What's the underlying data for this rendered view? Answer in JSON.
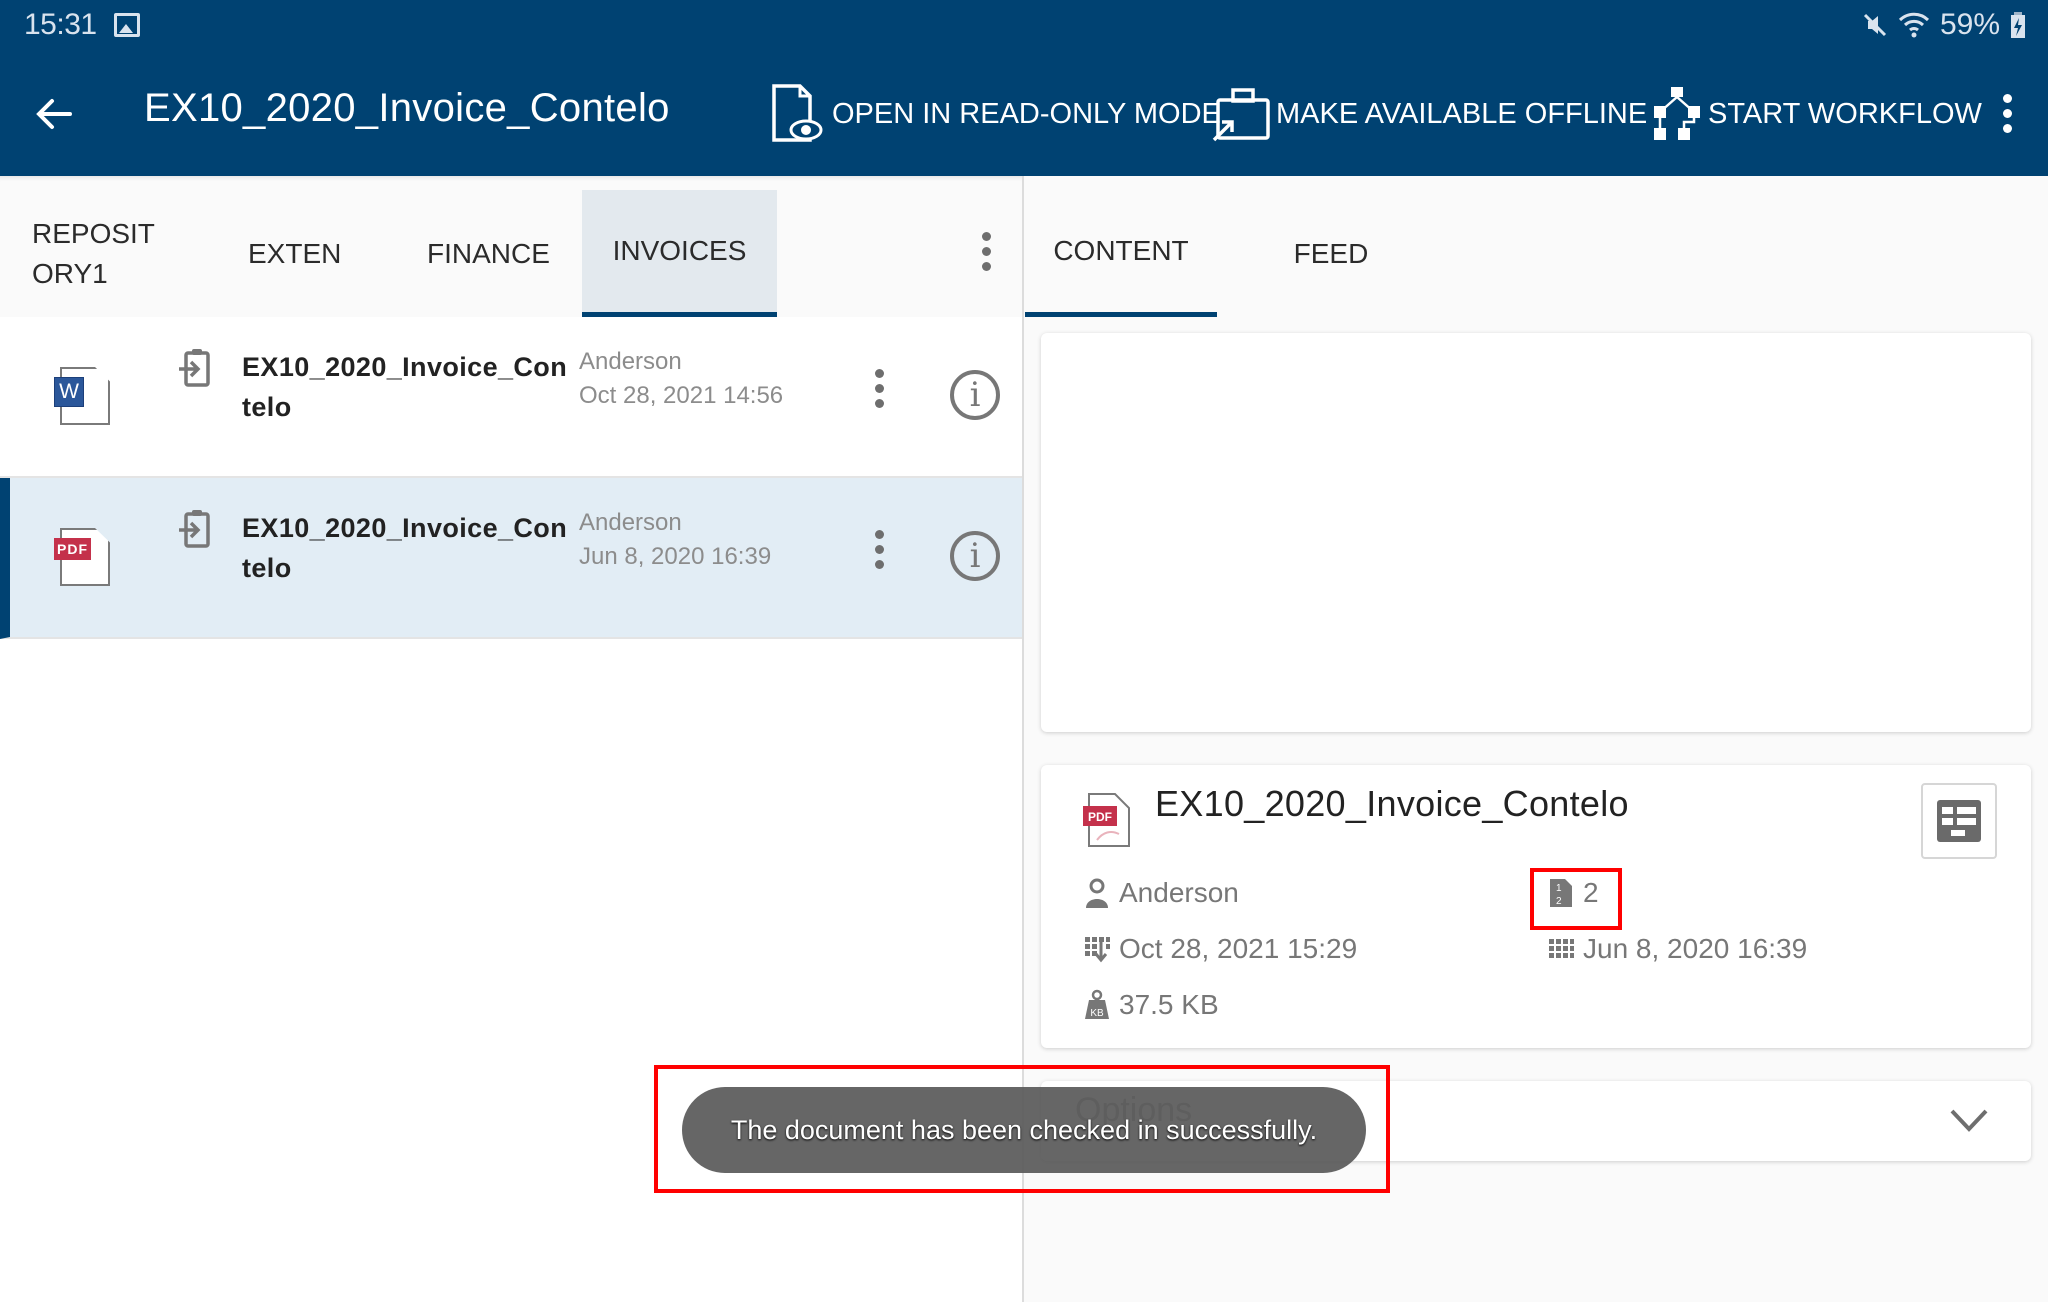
{
  "status_bar": {
    "time": "15:31",
    "battery": "59%",
    "icons": [
      "gallery-icon",
      "mute-icon",
      "wifi-icon",
      "battery-charging-icon"
    ]
  },
  "app_bar": {
    "title": "EX10_2020_Invoice_Contelo",
    "back_icon": "arrow-left-icon",
    "actions": [
      {
        "label": "OPEN IN READ-ONLY MODE",
        "icon": "document-eye-icon"
      },
      {
        "label": "MAKE AVAILABLE OFFLINE",
        "icon": "briefcase-arrow-icon"
      },
      {
        "label": "START WORKFLOW",
        "icon": "workflow-icon"
      }
    ],
    "overflow_icon": "more-vertical-icon"
  },
  "left_tabs": [
    {
      "label": "REPOSIT ORY1",
      "line1": "REPOSIT",
      "line2": "ORY1",
      "active": false
    },
    {
      "label": "EXTEN",
      "active": false
    },
    {
      "label": "FINANCE",
      "active": false
    },
    {
      "label": "INVOICES",
      "active": true
    }
  ],
  "file_list": [
    {
      "type": "word",
      "type_badge": "W",
      "name_line1": "EX10_2020_Invoice_Con",
      "name_line2": "telo",
      "author": "Anderson",
      "date": "Oct 28, 2021 14:56",
      "selected": false
    },
    {
      "type": "pdf",
      "type_badge": "PDF",
      "name_line1": "EX10_2020_Invoice_Con",
      "name_line2": "telo",
      "author": "Anderson",
      "date": "Jun 8, 2020 16:39",
      "selected": true
    }
  ],
  "right_tabs": [
    {
      "label": "CONTENT",
      "active": true
    },
    {
      "label": "FEED",
      "active": false
    }
  ],
  "details": {
    "type_badge": "PDF",
    "title": "EX10_2020_Invoice_Contelo",
    "author": "Anderson",
    "version": "2",
    "modified": "Oct 28, 2021 15:29",
    "created": "Jun 8, 2020 16:39",
    "size": "37.5 KB"
  },
  "options": {
    "label": "Options"
  },
  "toast": {
    "message": "The document has been checked in successfully."
  },
  "colors": {
    "brand": "#004272",
    "selected_row": "#e2edf5",
    "pdf_red": "#c4314b",
    "word_blue": "#2b579a",
    "highlight": "#ff0000"
  }
}
